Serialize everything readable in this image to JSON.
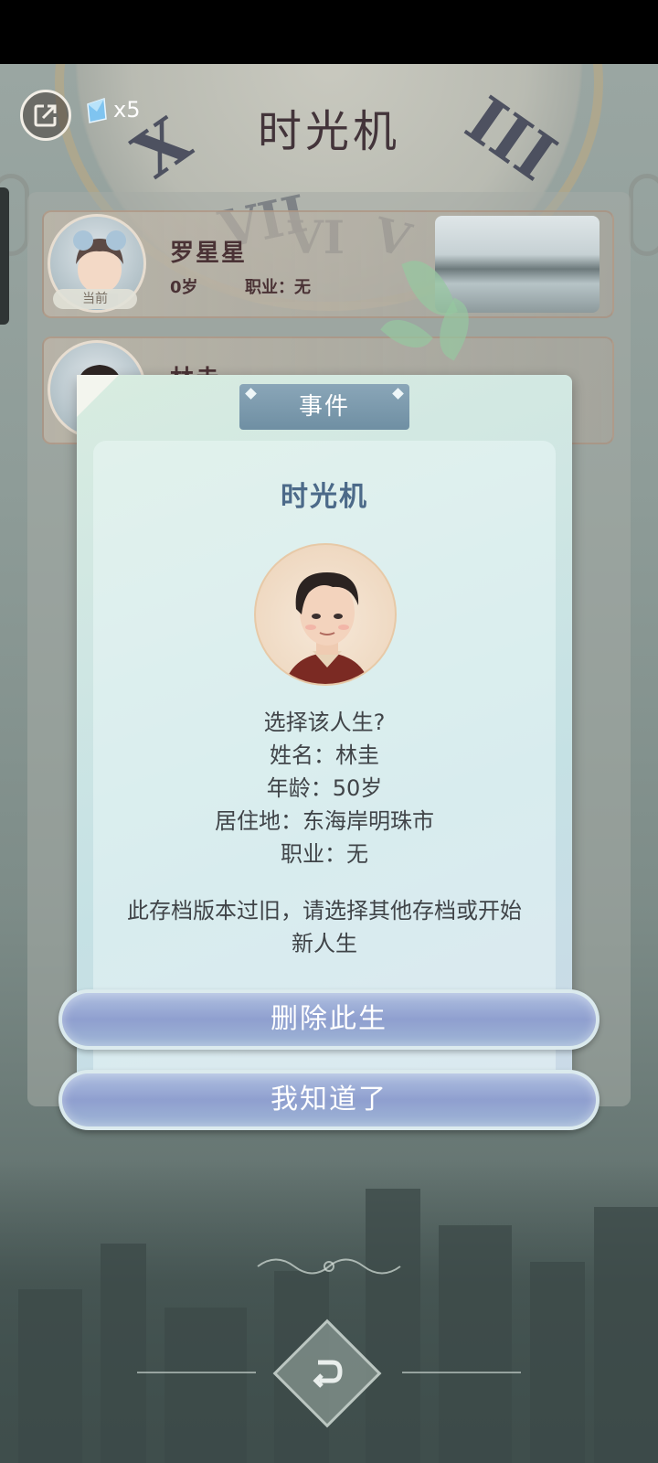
{
  "header": {
    "title": "时光机",
    "gem_count": "x5"
  },
  "slots": [
    {
      "name": "罗星星",
      "age": "0岁",
      "job": "职业：无",
      "tag": "当前"
    },
    {
      "name": "林圭"
    }
  ],
  "dialog": {
    "banner": "事件",
    "title": "时光机",
    "question": "选择该人生?",
    "name_line": "姓名：林圭",
    "age_line": "年龄：50岁",
    "residence_line": "居住地：东海岸明珠市",
    "job_line": "职业：无",
    "warning": "此存档版本过旧，请选择其他存档或开始新人生",
    "delete_button": "删除此生",
    "ok_button": "我知道了"
  },
  "colors": {
    "title_text": "#43343a",
    "dialog_title": "#4c6a89",
    "button_fill": "#8f9fcf",
    "banner_fill": "#6f8fa3"
  },
  "icons": {
    "exit": "exit-icon",
    "gem": "gem-icon",
    "back": "back-arrow-icon"
  }
}
